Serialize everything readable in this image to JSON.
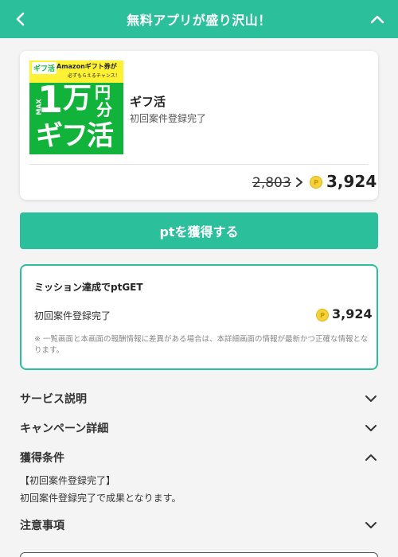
{
  "header": {
    "title": "無料アプリが盛り沢山！"
  },
  "offer": {
    "banner": {
      "logo": "ギフ活",
      "line1": "Amazonギフト券が",
      "line2": "必ずもらえるチャンス！",
      "big1": "1",
      "man": "万",
      "en": "円",
      "bun": "分",
      "max": "MAX",
      "gift": "ギフ活"
    },
    "name": "ギフ活",
    "subtitle": "初回案件登録完了",
    "old_points": "2,803",
    "new_points": "3,924",
    "coin_symbol": "P"
  },
  "main_button": {
    "label": "ptを獲得する"
  },
  "mission": {
    "title": "ミッション達成でptGET",
    "row_label": "初回案件登録完了",
    "row_points": "3,924",
    "note": "※ 一覧画面と本画面の報酬情報に差異がある場合は、本詳細画面の情報が最新かつ正確な情報となります。"
  },
  "sections": {
    "service": "サービス説明",
    "campaign": "キャンペーン詳細",
    "conditions": "獲得条件",
    "conditions_line1": "【初回案件登録完了】",
    "conditions_line2": "初回案件登録完了で成果となります。",
    "notes": "注意事項"
  },
  "colors": {
    "accent": "#2cbf9c",
    "coin": "#f4d23c"
  }
}
